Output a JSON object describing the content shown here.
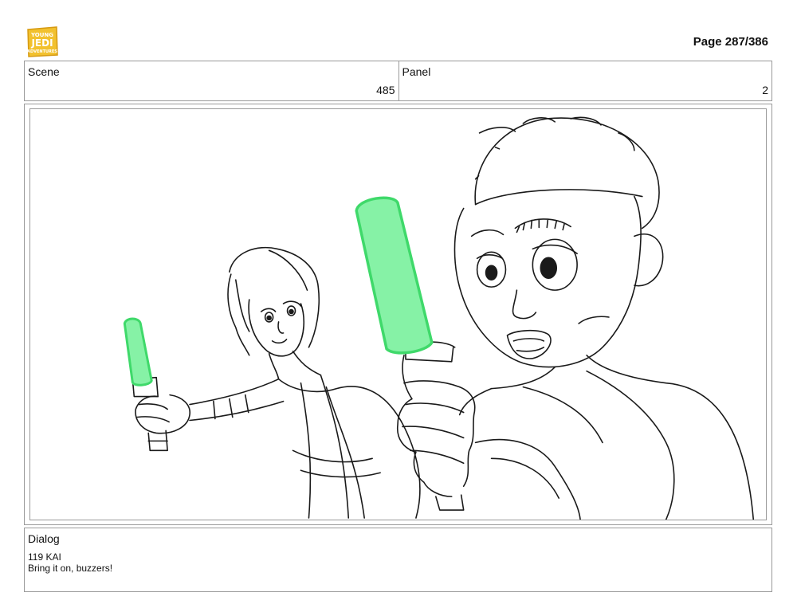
{
  "header": {
    "logo_text": "YOUNG JEDI ADVENTURES",
    "page_number": "Page 287/386"
  },
  "info": {
    "scene_label": "Scene",
    "scene_value": "485",
    "panel_label": "Panel",
    "panel_value": "2"
  },
  "colors": {
    "saber_fill": "#86f2a6",
    "saber_stroke": "#3fd96a",
    "logo_gold": "#f2c12e",
    "border": "#9a9a9a"
  },
  "dialog": {
    "label": "Dialog",
    "lines": [
      "119 KAI",
      "Bring it on, buzzers!"
    ]
  }
}
